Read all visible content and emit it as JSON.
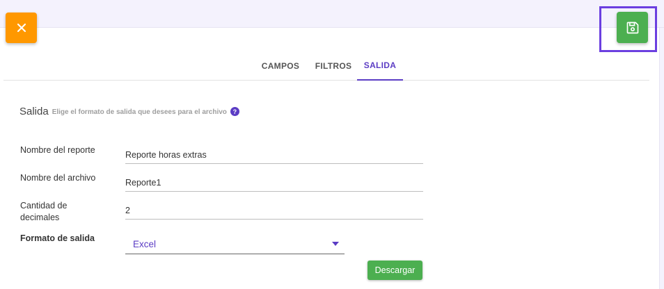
{
  "toolbar": {
    "close_icon": "close-icon",
    "save_icon": "floppy-disk-icon",
    "colors": {
      "close": "#ff9800",
      "save": "#4caf50",
      "highlight": "#6b3fe0"
    }
  },
  "tabs": [
    {
      "label": "CAMPOS",
      "active": false
    },
    {
      "label": "FILTROS",
      "active": false
    },
    {
      "label": "SALIDA",
      "active": true
    }
  ],
  "section": {
    "title": "Salida",
    "subtitle": "Elige el formato de salida que desees para el archivo",
    "help_icon": "?"
  },
  "form": {
    "report_name": {
      "label": "Nombre del reporte",
      "value": "Reporte horas extras"
    },
    "file_name": {
      "label": "Nombre del archivo",
      "value": "Reporte1"
    },
    "decimals": {
      "label_line1": "Cantidad de",
      "label_line2": "decimales",
      "value": "2"
    },
    "output_format": {
      "label": "Formato de salida",
      "selected": "Excel"
    }
  },
  "actions": {
    "download_label": "Descargar"
  },
  "colors": {
    "accent": "#5b3cc4"
  }
}
